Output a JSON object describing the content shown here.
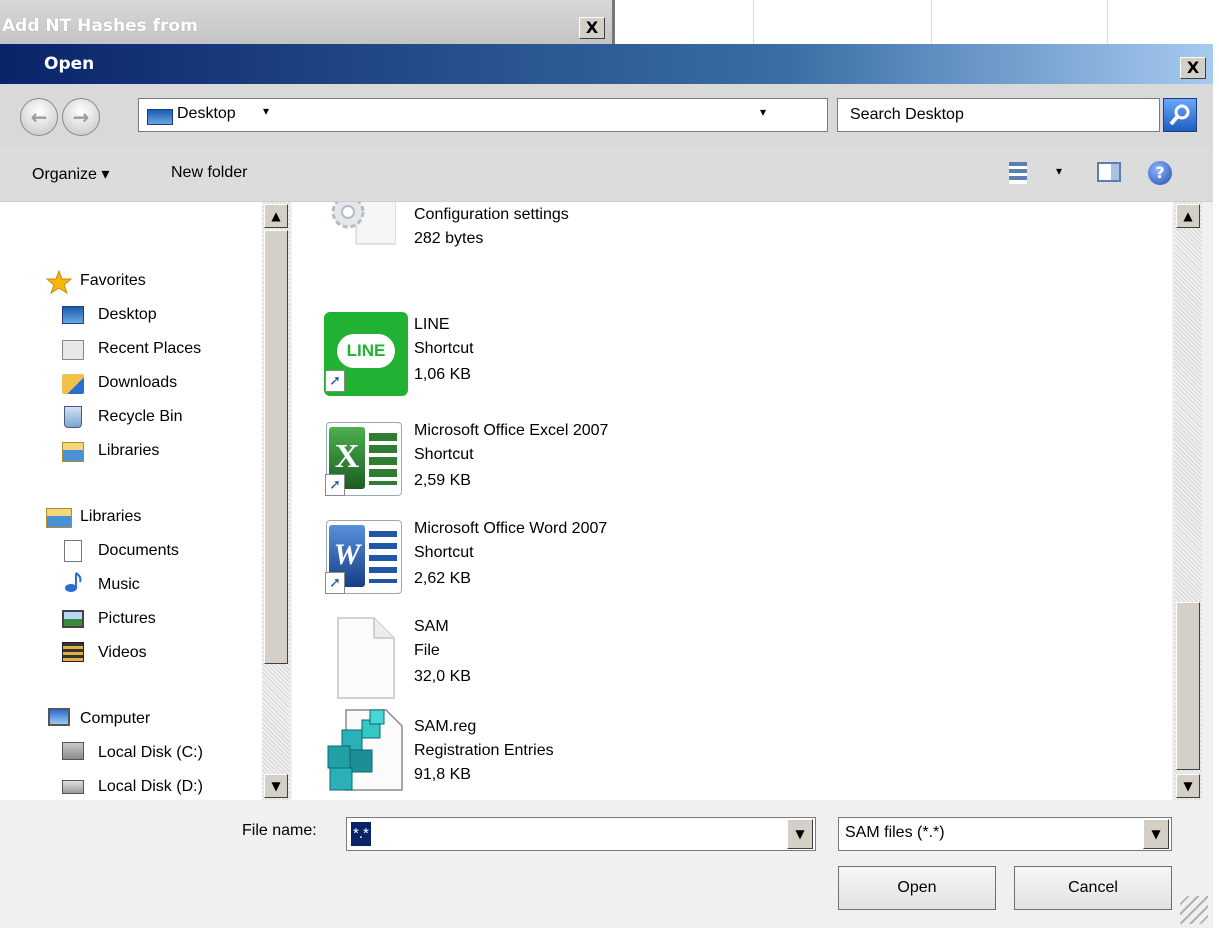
{
  "background_window": {
    "title": "Add NT Hashes from",
    "close_label": "X"
  },
  "dialog": {
    "title": "Open",
    "close_label": "X",
    "address": {
      "location": "Desktop",
      "chevron": "▾",
      "dropdown": "▾"
    },
    "search": {
      "placeholder": "Search Desktop"
    },
    "toolbar": {
      "organize": "Organize ▾",
      "new_folder": "New folder",
      "view_dropdown": "▾",
      "help": "?"
    },
    "nav": {
      "favorites_header": "Favorites",
      "favorites": [
        "Desktop",
        "Recent Places",
        "Downloads",
        "Recycle Bin",
        "Libraries"
      ],
      "libraries_header": "Libraries",
      "libraries": [
        "Documents",
        "Music",
        "Pictures",
        "Videos"
      ],
      "computer_header": "Computer",
      "drives": [
        "Local Disk (C:)",
        "Local Disk (D:)"
      ]
    },
    "files": [
      {
        "name": "Configuration settings",
        "type": "",
        "size": "282 bytes",
        "icon": "config-settings-icon"
      },
      {
        "name": "LINE",
        "type": "Shortcut",
        "size": "1,06 KB",
        "icon": "line-app-icon",
        "icon_text": "LINE"
      },
      {
        "name": "Microsoft Office Excel 2007",
        "type": "Shortcut",
        "size": "2,59 KB",
        "icon": "excel-icon",
        "icon_text": "X"
      },
      {
        "name": "Microsoft Office Word 2007",
        "type": "Shortcut",
        "size": "2,62 KB",
        "icon": "word-icon",
        "icon_text": "W"
      },
      {
        "name": "SAM",
        "type": "File",
        "size": "32,0 KB",
        "icon": "blank-file-icon"
      },
      {
        "name": "SAM.reg",
        "type": "Registration Entries",
        "size": "91,8 KB",
        "icon": "registry-icon"
      }
    ],
    "bottom": {
      "file_name_label": "File name:",
      "file_name_value": "*.*",
      "file_type": "SAM files (*.*)",
      "open_label": "Open",
      "cancel_label": "Cancel"
    },
    "colors": {
      "title_start": "#0a246a",
      "title_end": "#a6caf0",
      "line_green": "#21b233",
      "excel_green": "#2e7d32",
      "word_blue": "#1e56a8"
    }
  }
}
